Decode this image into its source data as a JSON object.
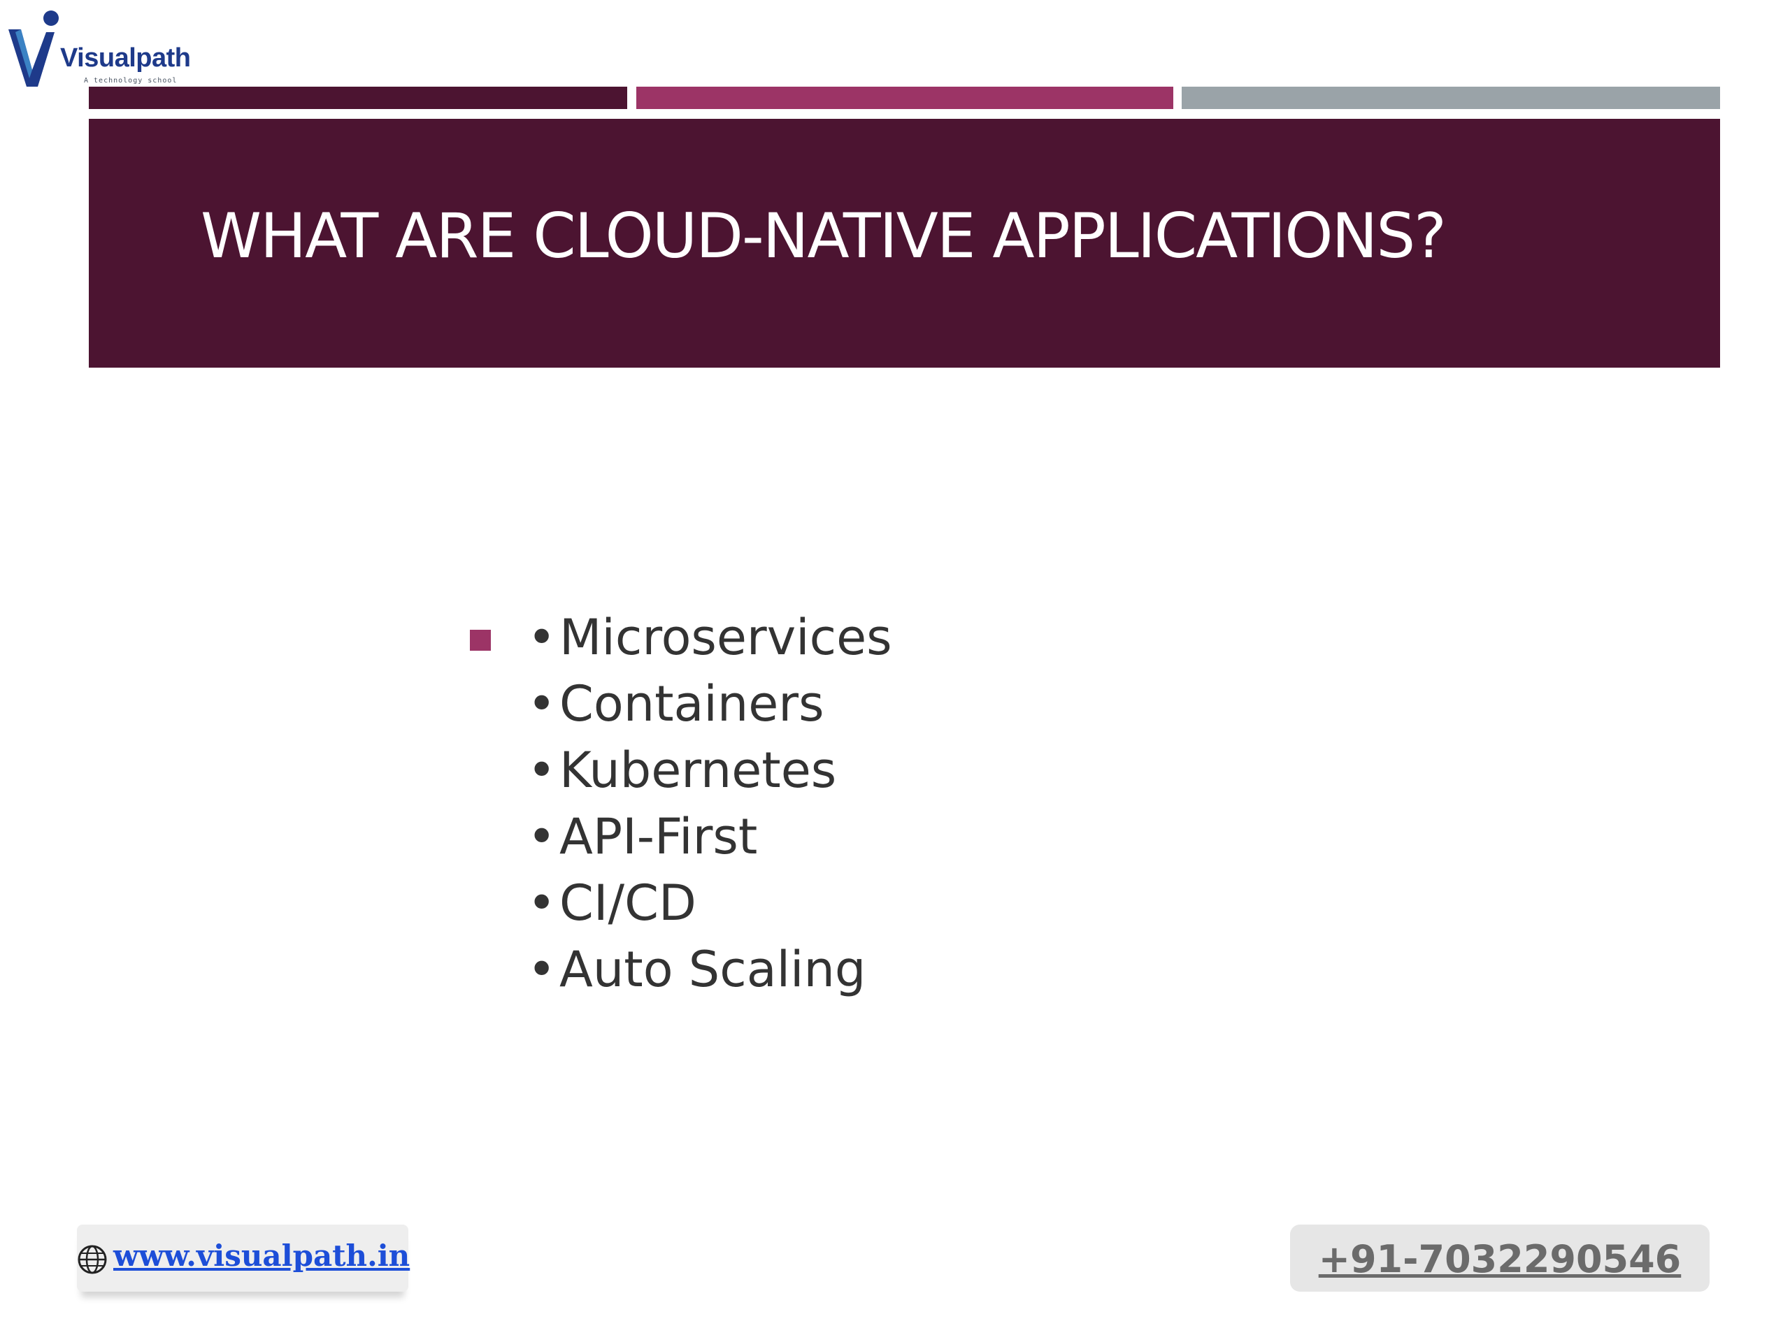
{
  "logo": {
    "name": "Visualpath",
    "tagline": "A technology school",
    "icon": "visualpath-v-logo"
  },
  "colors": {
    "title_background": "#4c1431",
    "accent_dark": "#4c1431",
    "accent_magenta": "#9c3466",
    "accent_gray": "#9aa3a8",
    "bullet_marker": "#9c3466"
  },
  "slide": {
    "title": "WHAT ARE CLOUD-NATIVE APPLICATIONS?",
    "list_marker_icon": "square-bullet-icon",
    "bullet_glyph": "•",
    "bullets": [
      {
        "text": "Microservices"
      },
      {
        "text": "Containers"
      },
      {
        "text": "Kubernetes"
      },
      {
        "text": "API-First"
      },
      {
        "text": "CI/CD"
      },
      {
        "text": "Auto Scaling"
      }
    ]
  },
  "footer": {
    "website": "www.visualpath.in",
    "website_icon": "globe-icon",
    "phone": "+91-7032290546"
  }
}
